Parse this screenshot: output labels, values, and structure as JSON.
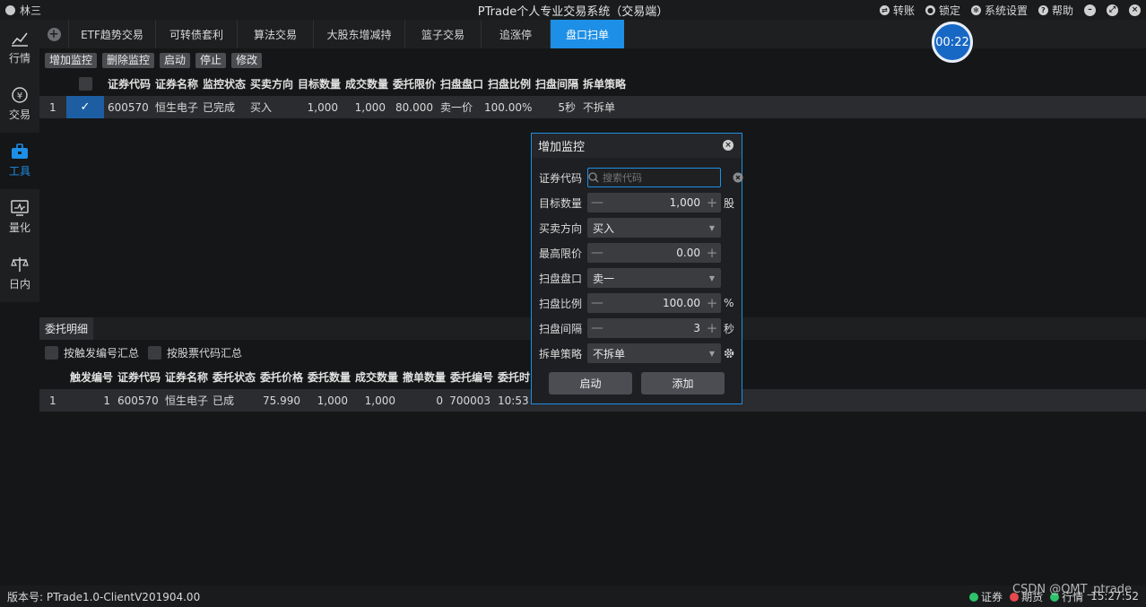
{
  "titlebar": {
    "user": "林三",
    "title": "PTrade个人专业交易系统（交易端）",
    "actions": [
      {
        "icon": "transfer-icon",
        "label": "转账"
      },
      {
        "icon": "lock-icon",
        "label": "锁定"
      },
      {
        "icon": "gear-icon",
        "label": "系统设置"
      },
      {
        "icon": "help-icon",
        "label": "帮助"
      }
    ]
  },
  "sidebar": {
    "items": [
      {
        "label": "行情",
        "icon": "chart-icon"
      },
      {
        "label": "交易",
        "icon": "yen-icon"
      },
      {
        "label": "工具",
        "icon": "toolbox-icon"
      },
      {
        "label": "量化",
        "icon": "monitor-icon"
      },
      {
        "label": "日内",
        "icon": "scale-icon"
      }
    ],
    "active": 2
  },
  "tabs": [
    "ETF趋势交易",
    "可转债套利",
    "算法交易",
    "大股东增减持",
    "篮子交易",
    "追涨停",
    "盘口扫单"
  ],
  "active_tab": 6,
  "timer": "00:22",
  "toolbar": {
    "add": "增加监控",
    "delete": "删除监控",
    "start": "启动",
    "stop": "停止",
    "edit": "修改"
  },
  "monitor_table": {
    "columns": [
      "证券代码",
      "证券名称",
      "监控状态",
      "买卖方向",
      "目标数量",
      "成交数量",
      "委托限价",
      "扫盘盘口",
      "扫盘比例",
      "扫盘间隔",
      "拆单策略"
    ],
    "rows": [
      {
        "index": "1",
        "checked": true,
        "cells": [
          "600570",
          "恒生电子",
          "已完成",
          "买入",
          "1,000",
          "1,000",
          "80.000",
          "卖一价",
          "100.00%",
          "5秒",
          "不拆单"
        ]
      }
    ]
  },
  "detail": {
    "tab": "委托明细",
    "option1": "按触发编号汇总",
    "option2": "按股票代码汇总",
    "columns": [
      "触发编号",
      "证券代码",
      "证券名称",
      "委托状态",
      "委托价格",
      "委托数量",
      "成交数量",
      "撤单数量",
      "委托编号",
      "委托时"
    ],
    "rows": [
      {
        "index": "1",
        "cells": [
          "1",
          "600570",
          "恒生电子",
          "已成",
          "75.990",
          "1,000",
          "1,000",
          "0",
          "700003",
          "10:53:"
        ]
      }
    ]
  },
  "dialog": {
    "title": "增加监控",
    "code_label": "证券代码",
    "code_placeholder": "搜索代码",
    "qty_label": "目标数量",
    "qty_value": "1,000",
    "qty_unit": "股",
    "side_label": "买卖方向",
    "side_value": "买入",
    "price_label": "最高限价",
    "price_value": "0.00",
    "level_label": "扫盘盘口",
    "level_value": "卖一",
    "ratio_label": "扫盘比例",
    "ratio_value": "100.00",
    "ratio_unit": "%",
    "interval_label": "扫盘间隔",
    "interval_value": "3",
    "interval_unit": "秒",
    "split_label": "拆单策略",
    "split_value": "不拆单",
    "start_button": "启动",
    "add_button": "添加"
  },
  "statusbar": {
    "version": "版本号:  PTrade1.0-ClientV201904.00",
    "indicators": [
      {
        "label": "证券",
        "color": "#2ec26a"
      },
      {
        "label": "期货",
        "color": "#e5484d"
      },
      {
        "label": "行情",
        "color": "#2ec26a"
      }
    ],
    "time": "15:27:52"
  },
  "watermark": "CSDN @QMT_ptrade"
}
